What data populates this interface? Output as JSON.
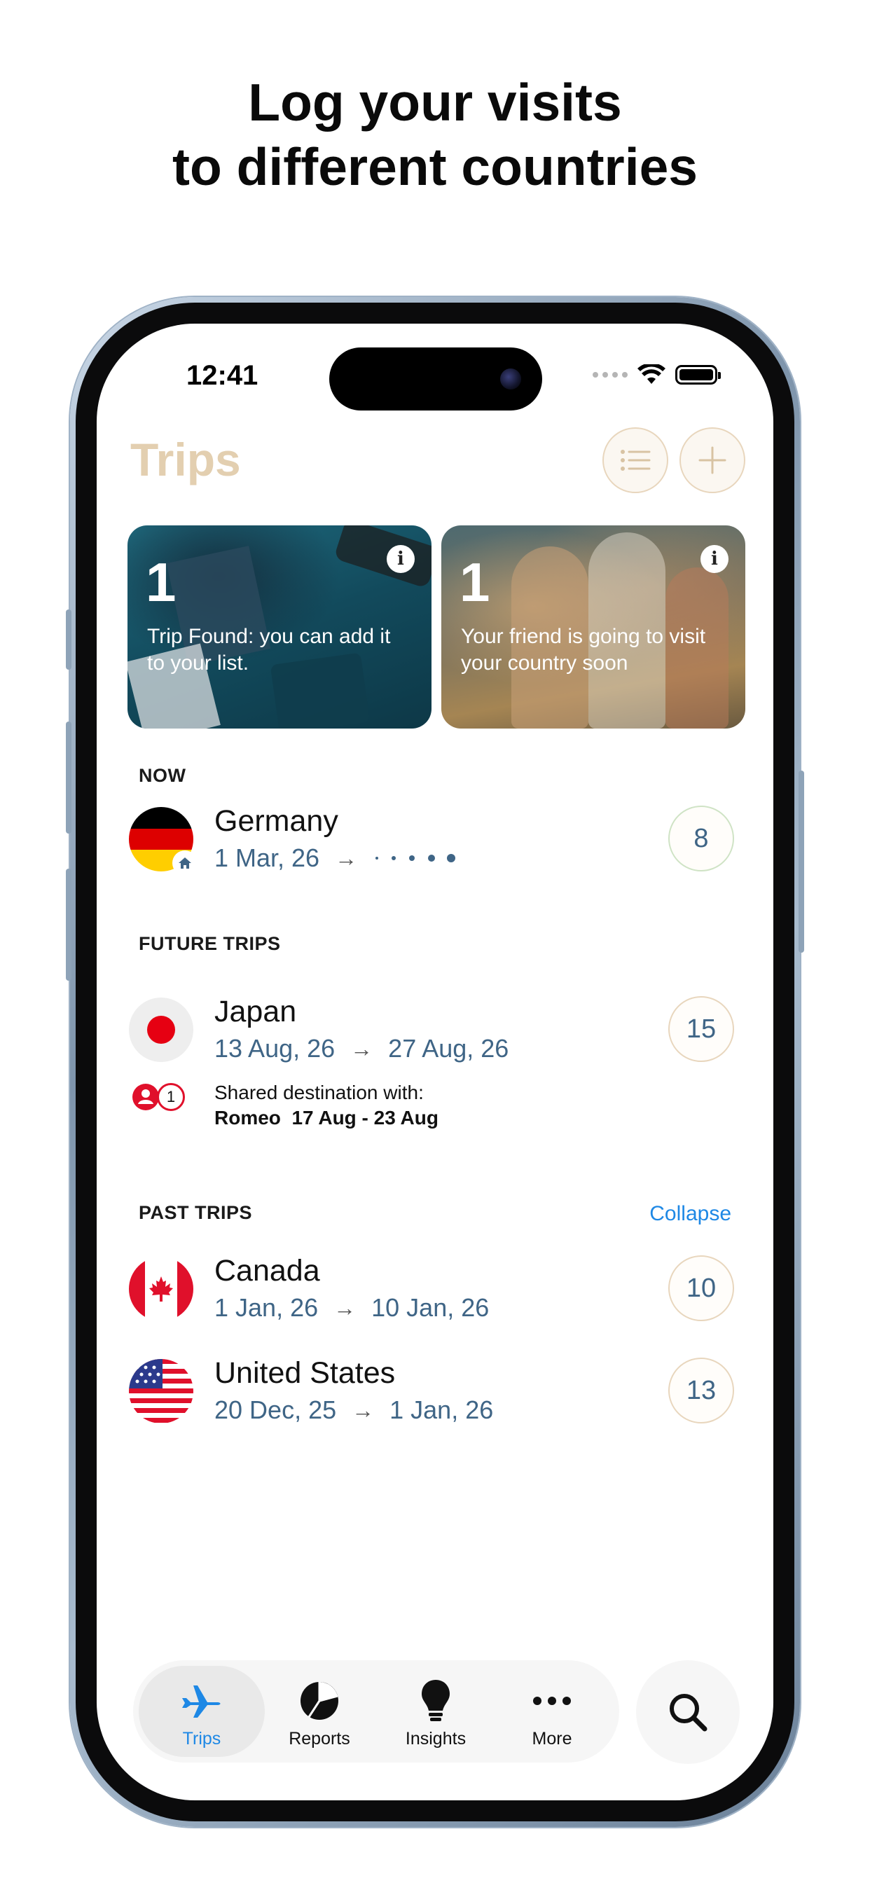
{
  "headline": {
    "line1": "Log your visits",
    "line2": "to different countries"
  },
  "status": {
    "time": "12:41"
  },
  "header": {
    "title": "Trips"
  },
  "cards": [
    {
      "count": "1",
      "text": "Trip Found: you can add it to your list."
    },
    {
      "count": "1",
      "text": "Your friend is going to visit your country soon"
    }
  ],
  "sections": {
    "now": "NOW",
    "future": "FUTURE TRIPS",
    "past": "PAST TRIPS",
    "collapse": "Collapse"
  },
  "now": [
    {
      "country": "Germany",
      "start": "1 Mar, 26",
      "count": "8"
    }
  ],
  "future": [
    {
      "country": "Japan",
      "start": "13 Aug, 26",
      "end": "27 Aug, 26",
      "count": "15",
      "shared_label": "Shared destination with:",
      "shared_name": "Romeo",
      "shared_dates": "17 Aug - 23 Aug",
      "shared_count": "1"
    }
  ],
  "past": [
    {
      "country": "Canada",
      "start": "1 Jan, 26",
      "end": "10 Jan, 26",
      "count": "10"
    },
    {
      "country": "United States",
      "start": "20 Dec, 25",
      "end": "1 Jan, 26",
      "count": "13"
    }
  ],
  "tabs": [
    {
      "label": "Trips",
      "icon": "airplane-icon",
      "active": true
    },
    {
      "label": "Reports",
      "icon": "pie-chart-icon"
    },
    {
      "label": "Insights",
      "icon": "lightbulb-icon"
    },
    {
      "label": "More",
      "icon": "more-icon"
    }
  ],
  "colors": {
    "accent": "#1e88e5",
    "title": "#e3cfb0",
    "date": "#3f6586",
    "badge_border": "#e8d6bd"
  }
}
